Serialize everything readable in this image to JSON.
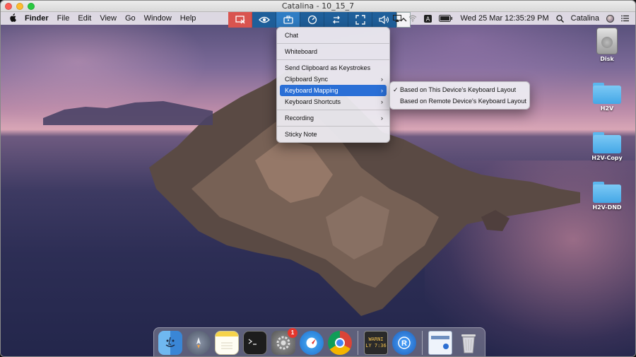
{
  "window": {
    "title": "Catalina - 10_15_7"
  },
  "menubar": {
    "app_name": "Finder",
    "items": [
      "File",
      "Edit",
      "View",
      "Go",
      "Window",
      "Help"
    ],
    "datetime": "Wed 25 Mar  12:35:29 PM",
    "user": "Catalina"
  },
  "toolbar": {
    "icons": [
      "disconnect-icon",
      "view-eye-icon",
      "toolbox-icon",
      "speed-dial-icon",
      "transfer-arrows-icon",
      "fullscreen-icon",
      "audio-icon",
      "collapse-chevron-icon"
    ],
    "active": "toolbox-icon"
  },
  "tools_menu": {
    "items": [
      {
        "label": "Chat",
        "arrow": ""
      },
      {
        "label": "Whiteboard",
        "arrow": ""
      },
      {
        "label": "Send Clipboard as Keystrokes",
        "arrow": ""
      },
      {
        "label": "Clipboard Sync",
        "arrow": "›"
      },
      {
        "label": "Keyboard Mapping",
        "arrow": "›"
      },
      {
        "label": "Keyboard Shortcuts",
        "arrow": "›"
      },
      {
        "label": "Recording",
        "arrow": "›"
      },
      {
        "label": "Sticky Note",
        "arrow": ""
      }
    ],
    "highlighted": "Keyboard Mapping"
  },
  "keyboard_mapping_submenu": {
    "items": [
      {
        "label": "Based on This Device's Keyboard Layout",
        "checked": true
      },
      {
        "label": "Based on Remote Device's Keyboard Layout",
        "checked": false
      }
    ],
    "check_glyph": "✓"
  },
  "desktop_icons": [
    "Disk",
    "H2V",
    "H2V-Copy",
    "H2V-DND"
  ],
  "dock": {
    "apps": [
      "finder-icon",
      "launchpad-icon",
      "notes-icon",
      "terminal-icon",
      "system-preferences-icon",
      "safari-icon",
      "chrome-icon",
      "console-icon",
      "remote-app-icon",
      "preview-window-icon",
      "trash-icon"
    ],
    "system_preferences_badge": "1",
    "console_text": "WARNI\nLY 7:36"
  },
  "colors": {
    "menu_highlight": "#2a6fd6",
    "toolbar_blue": "#1f5f9a",
    "toolbar_red": "#d9544f",
    "folder_blue": "#5bb6ee"
  }
}
